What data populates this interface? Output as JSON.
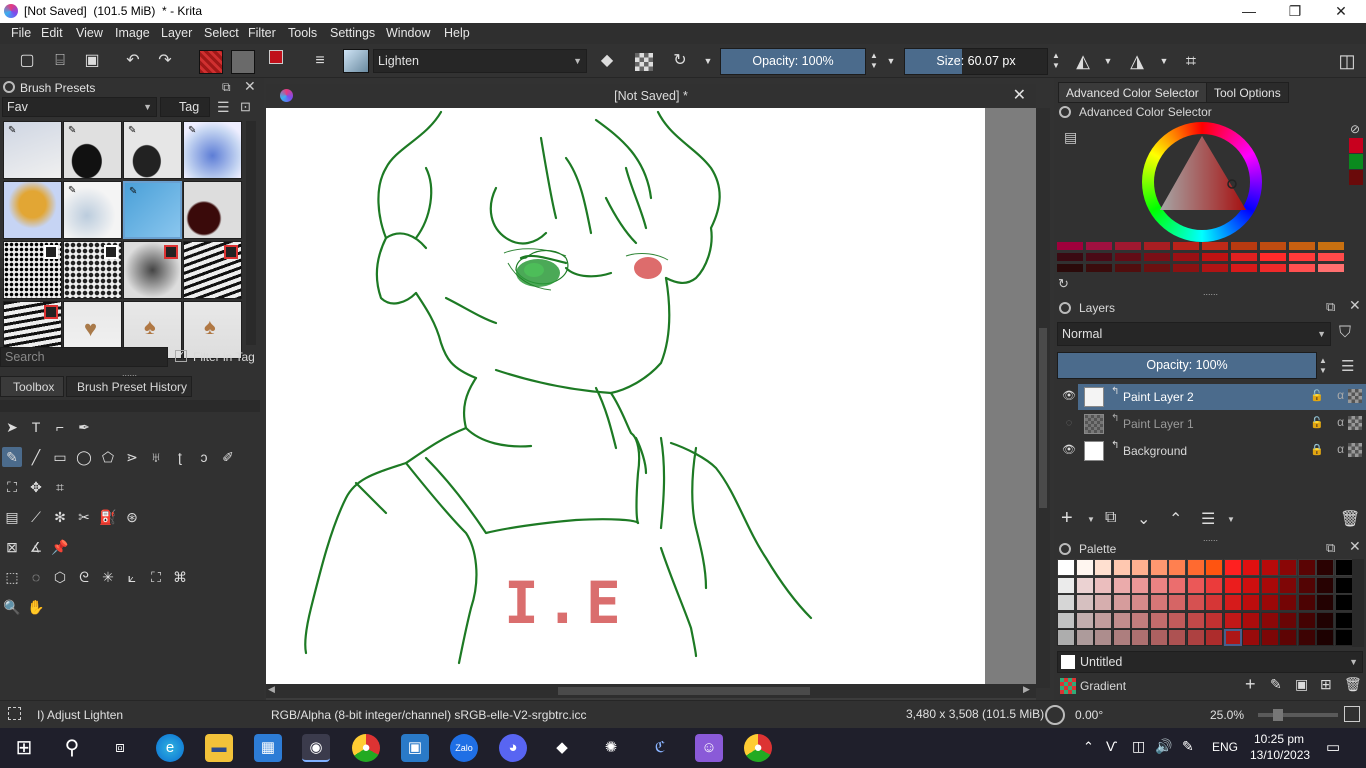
{
  "window": {
    "title": "[Not Saved]  (101.5 MiB)  * - Krita",
    "minimize": "—",
    "maximize": "❐",
    "close": "✕"
  },
  "menu": [
    "File",
    "Edit",
    "View",
    "Image",
    "Layer",
    "Select",
    "Filter",
    "Tools",
    "Settings",
    "Window",
    "Help"
  ],
  "toolbar": {
    "blend_mode": "Lighten",
    "opacity": "Opacity: 100%",
    "opacity_fraction": 1.0,
    "size": "Size: 60.07 px",
    "size_fraction": 0.4
  },
  "brush_presets": {
    "title": "Brush Presets",
    "tag_filter": "Fav",
    "tag_button": "Tag",
    "search_placeholder": "Search",
    "filter_in_tag": "Filter in Tag"
  },
  "left_tabs": [
    "Toolbox",
    "Brush Preset History"
  ],
  "canvas": {
    "tab_title": "[Not Saved]  *",
    "drawn_text": "I.E"
  },
  "right_tabs": [
    "Advanced Color Selector",
    "Tool Options"
  ],
  "color_selector": {
    "title": "Advanced Color Selector",
    "recent_colors": [
      "#c8001e",
      "#0a8a1e",
      "#6a0a0a"
    ]
  },
  "layers": {
    "title": "Layers",
    "blend_mode": "Normal",
    "opacity": "Opacity:  100%",
    "items": [
      {
        "name": "Paint Layer 2",
        "selected": true,
        "visible": true
      },
      {
        "name": "Paint Layer 1",
        "selected": false,
        "visible": false
      },
      {
        "name": "Background",
        "selected": false,
        "visible": true
      }
    ]
  },
  "palette": {
    "title": "Palette",
    "name": "Untitled",
    "gradient": "Gradient"
  },
  "status": {
    "tool_hint": "I) Adjust Lighten",
    "color_space": "RGB/Alpha (8-bit integer/channel)  sRGB-elle-V2-srgbtrc.icc",
    "dimensions": "3,480 x 3,508 (101.5 MiB)",
    "rotation": "0.00°",
    "zoom": "25.0%"
  },
  "taskbar": {
    "time": "10:25 pm",
    "date": "13/10/2023",
    "lang": "ENG"
  }
}
